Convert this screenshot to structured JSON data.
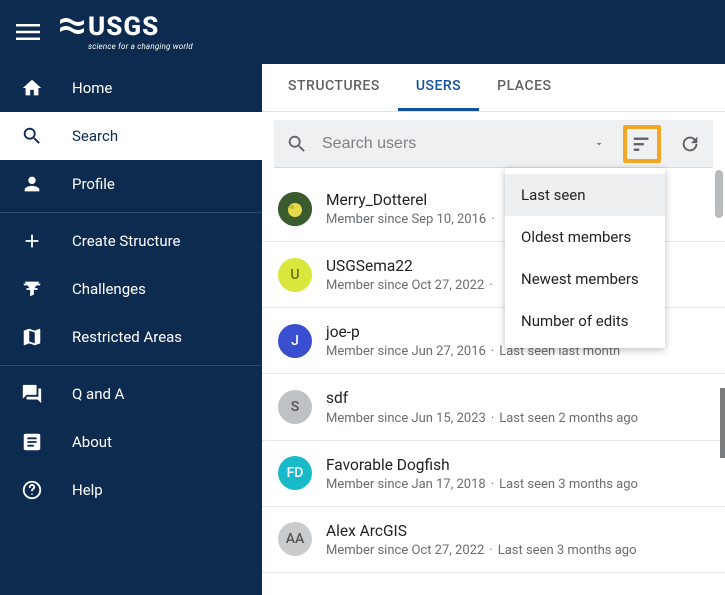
{
  "logo": {
    "text": "USGS",
    "tagline": "science for a changing world"
  },
  "sidebar": {
    "items": [
      {
        "key": "home",
        "label": "Home"
      },
      {
        "key": "search",
        "label": "Search"
      },
      {
        "key": "profile",
        "label": "Profile"
      },
      {
        "key": "create",
        "label": "Create Structure"
      },
      {
        "key": "challenges",
        "label": "Challenges"
      },
      {
        "key": "restricted",
        "label": "Restricted Areas"
      },
      {
        "key": "qa",
        "label": "Q and A"
      },
      {
        "key": "about",
        "label": "About"
      },
      {
        "key": "help",
        "label": "Help"
      }
    ]
  },
  "tabs": [
    {
      "key": "structures",
      "label": "STRUCTURES"
    },
    {
      "key": "users",
      "label": "USERS"
    },
    {
      "key": "places",
      "label": "PLACES"
    }
  ],
  "search": {
    "placeholder": "Search users",
    "value": ""
  },
  "sort_menu": [
    "Last seen",
    "Oldest members",
    "Newest members",
    "Number of edits"
  ],
  "users": [
    {
      "name": "Merry_Dotterel",
      "member_since": "Member since Sep 10, 2016",
      "last_seen": "",
      "avatar_bg": "#3a5b2e",
      "avatar_label": "",
      "avatar_image": true
    },
    {
      "name": "USGSema22",
      "member_since": "Member since Oct 27, 2022",
      "last_seen": "",
      "avatar_bg": "#d9e63b",
      "avatar_label": "U",
      "avatar_text": "#6a6d00"
    },
    {
      "name": "joe-p",
      "member_since": "Member since Jun 27, 2016",
      "last_seen": "Last seen last month",
      "avatar_bg": "#3a4fcf",
      "avatar_label": "J"
    },
    {
      "name": "sdf",
      "member_since": "Member since Jun 15, 2023",
      "last_seen": "Last seen 2 months ago",
      "avatar_bg": "#bfc2c4",
      "avatar_label": "S",
      "avatar_text": "#555"
    },
    {
      "name": "Favorable Dogfish",
      "member_since": "Member since Jan 17, 2018",
      "last_seen": "Last seen 3 months ago",
      "avatar_bg": "#18bac9",
      "avatar_label": "FD"
    },
    {
      "name": "Alex ArcGIS",
      "member_since": "Member since Oct 27, 2022",
      "last_seen": "Last seen 3 months ago",
      "avatar_bg": "#c9cbcd",
      "avatar_label": "AA",
      "avatar_text": "#555"
    }
  ]
}
